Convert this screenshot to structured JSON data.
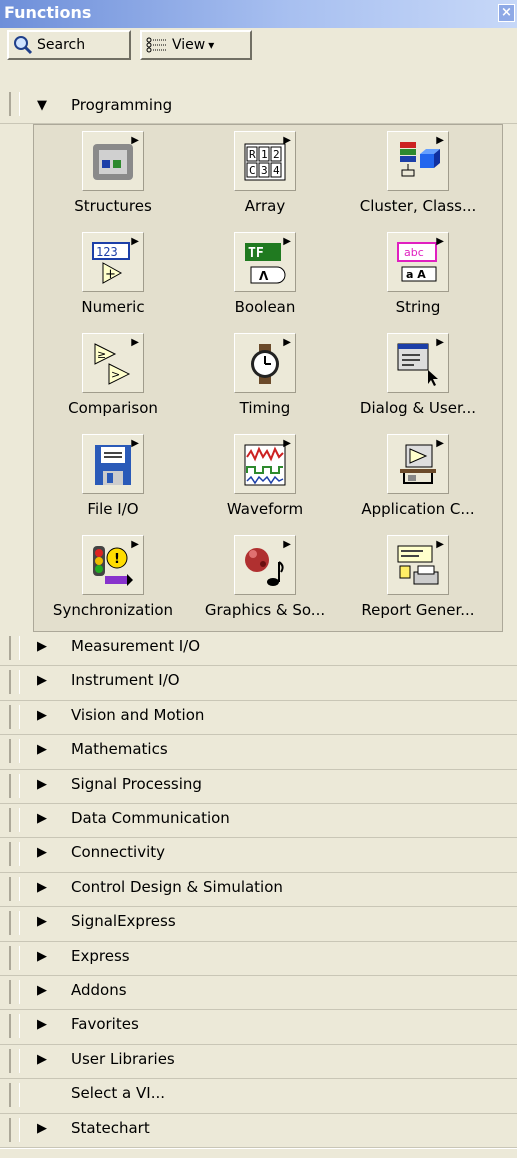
{
  "window": {
    "title": "Functions",
    "close_label": "×"
  },
  "toolbar": {
    "search_label": "Search",
    "view_label": "View"
  },
  "programming": {
    "header": "Programming",
    "items": [
      {
        "label": "Structures",
        "icon": "structures-icon"
      },
      {
        "label": "Array",
        "icon": "array-icon"
      },
      {
        "label": "Cluster, Class...",
        "icon": "cluster-class-icon"
      },
      {
        "label": "Numeric",
        "icon": "numeric-icon"
      },
      {
        "label": "Boolean",
        "icon": "boolean-icon"
      },
      {
        "label": "String",
        "icon": "string-icon"
      },
      {
        "label": "Comparison",
        "icon": "comparison-icon"
      },
      {
        "label": "Timing",
        "icon": "timing-icon"
      },
      {
        "label": "Dialog & User...",
        "icon": "dialog-user-icon"
      },
      {
        "label": "File I/O",
        "icon": "file-io-icon"
      },
      {
        "label": "Waveform",
        "icon": "waveform-icon"
      },
      {
        "label": "Application C...",
        "icon": "application-control-icon"
      },
      {
        "label": "Synchronization",
        "icon": "synchronization-icon"
      },
      {
        "label": "Graphics & So...",
        "icon": "graphics-sound-icon"
      },
      {
        "label": "Report Gener...",
        "icon": "report-generation-icon"
      }
    ],
    "icon_text": {
      "array": [
        "R",
        "1",
        "2",
        "C",
        "3",
        "4"
      ],
      "numeric": "123",
      "boolean": "TF",
      "string": "abc",
      "string_sub": "a A"
    }
  },
  "categories": [
    "Measurement I/O",
    "Instrument I/O",
    "Vision and Motion",
    "Mathematics",
    "Signal Processing",
    "Data Communication",
    "Connectivity",
    "Control Design & Simulation",
    "SignalExpress",
    "Express",
    "Addons",
    "Favorites",
    "User Libraries",
    "Select a VI...",
    "Statechart"
  ],
  "glyphs": {
    "expanded": "▼",
    "collapsed": "▶",
    "submenu": "▶",
    "dropdown": "▾"
  },
  "colors": {
    "title_start": "#6e8fd9",
    "title_end": "#c7d8f8",
    "bg": "#ece9d8",
    "palette_bg": "#e3dfcd"
  }
}
